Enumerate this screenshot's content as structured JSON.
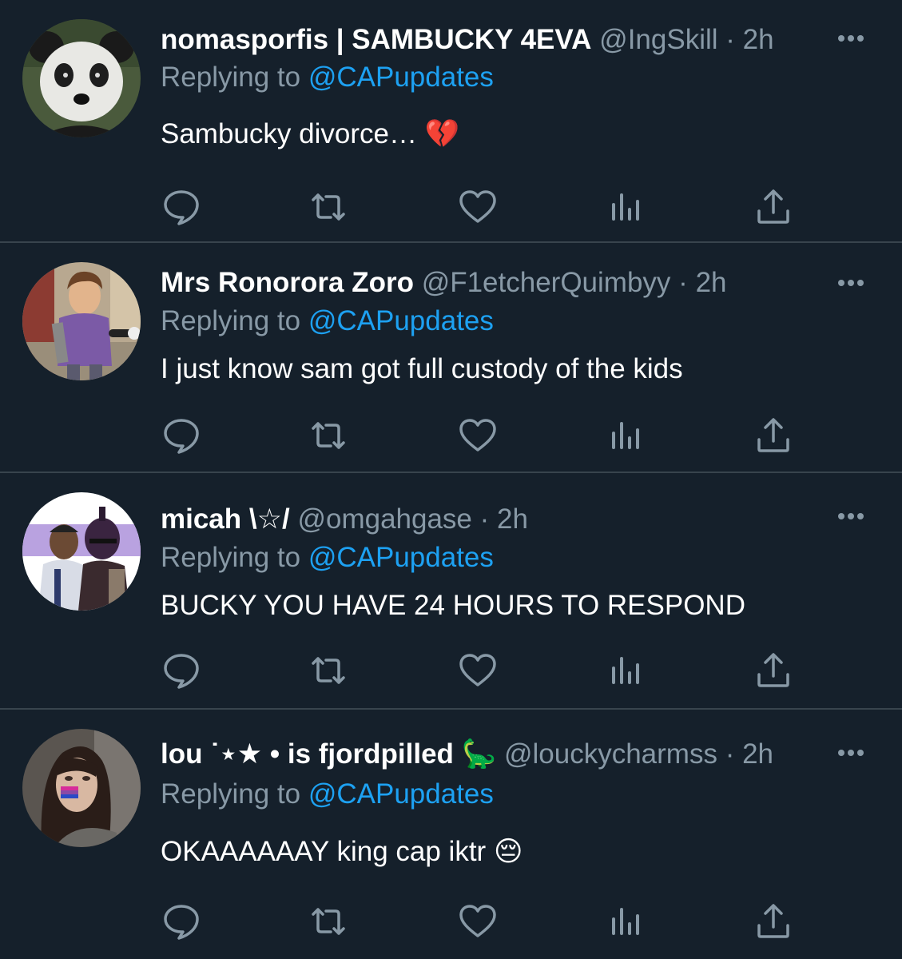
{
  "tweets": [
    {
      "name": "nomasporfis | SAMBUCKY 4EVA",
      "handle": "@IngSkill",
      "time": "2h",
      "replying_label": "Replying to",
      "replying_to": "@CAPupdates",
      "text": "Sambucky divorce…",
      "emoji": "💔",
      "avatar_icon": "panda-avatar"
    },
    {
      "name": "Mrs Ronorora Zoro",
      "handle": "@F1etcherQuimbyy",
      "time": "2h",
      "replying_label": "Replying to",
      "replying_to": "@CAPupdates",
      "text": "I just know sam got full custody of the kids",
      "avatar_icon": "boy-purple-shirt-avatar"
    },
    {
      "name": "micah",
      "name_deco": "\\☆/",
      "handle": "@omgahgase",
      "time": "2h",
      "replying_label": "Replying to",
      "replying_to": "@CAPupdates",
      "text": "BUCKY YOU HAVE 24 HOURS TO RESPOND",
      "avatar_icon": "illustrated-heroes-avatar"
    },
    {
      "name": "lou ˙⋆★ • is fjordpilled",
      "name_deco": "🦕",
      "handle": "@louckycharmss",
      "time": "2h",
      "replying_label": "Replying to",
      "replying_to": "@CAPupdates",
      "text": "OKAAAAAAY king cap iktr",
      "emoji": "😔",
      "avatar_icon": "woman-with-flag-paint-avatar"
    }
  ],
  "separator": "·",
  "colors": {
    "background": "#15202b",
    "text": "#ffffff",
    "muted": "#8899a6",
    "link": "#1da1f2",
    "divider": "#38444d"
  },
  "action_icons": [
    "reply-icon",
    "retweet-icon",
    "like-icon",
    "analytics-icon",
    "share-icon"
  ]
}
